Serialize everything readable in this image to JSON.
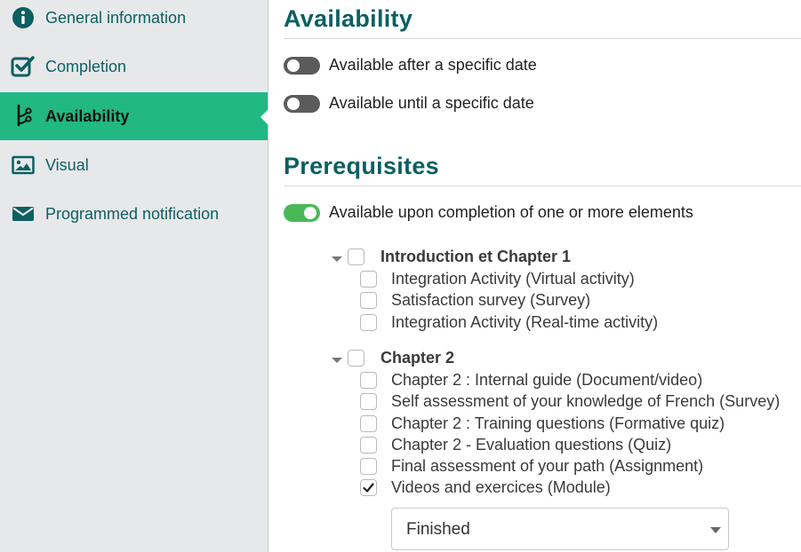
{
  "sidebar": {
    "items": [
      {
        "label": "General information",
        "icon": "info-circle-icon"
      },
      {
        "label": "Completion",
        "icon": "checkbox-check-icon"
      },
      {
        "label": "Availability",
        "icon": "branch-icon",
        "active": true
      },
      {
        "label": "Visual",
        "icon": "image-icon"
      },
      {
        "label": "Programmed notification",
        "icon": "envelope-icon"
      }
    ]
  },
  "availability": {
    "title": "Availability",
    "toggles": [
      {
        "label": "Available after a specific date",
        "on": false
      },
      {
        "label": "Available until a specific date",
        "on": false
      }
    ]
  },
  "prerequisites": {
    "title": "Prerequisites",
    "toggle": {
      "label": "Available upon completion of one or more elements",
      "on": true
    },
    "groups": [
      {
        "title": "Introduction et Chapter 1",
        "checked": false,
        "items": [
          {
            "label": "Integration Activity (Virtual activity)",
            "checked": false
          },
          {
            "label": "Satisfaction survey (Survey)",
            "checked": false
          },
          {
            "label": "Integration Activity (Real-time activity)",
            "checked": false
          }
        ]
      },
      {
        "title": "Chapter 2",
        "checked": false,
        "items": [
          {
            "label": "Chapter 2 : Internal guide (Document/video)",
            "checked": false
          },
          {
            "label": "Self assessment of your knowledge of French (Survey)",
            "checked": false
          },
          {
            "label": "Chapter 2 : Training questions (Formative quiz)",
            "checked": false
          },
          {
            "label": "Chapter 2 - Evaluation questions (Quiz)",
            "checked": false
          },
          {
            "label": "Final assessment of your path (Assignment)",
            "checked": false
          },
          {
            "label": "Videos and exercices (Module)",
            "checked": true
          }
        ]
      }
    ],
    "status_select": {
      "value": "Finished"
    }
  },
  "colors": {
    "accent": "#21b883",
    "heading": "#0c5f62",
    "toggle_on": "#49b957",
    "toggle_off": "#5b5b5b",
    "sidebar_bg": "#e7e8ea"
  }
}
